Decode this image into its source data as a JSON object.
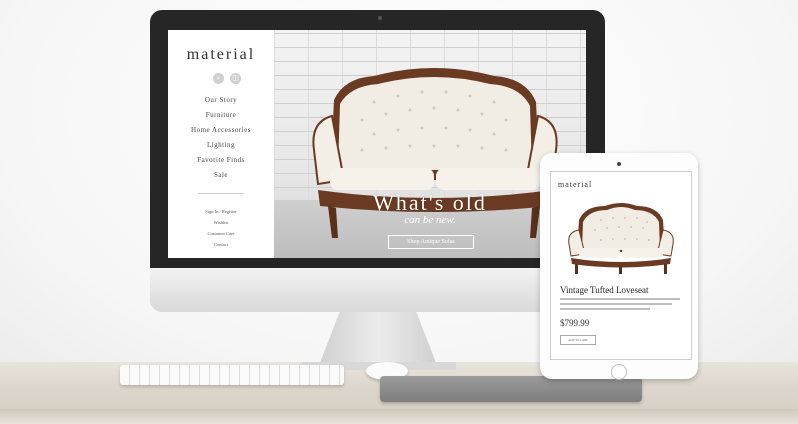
{
  "desktop_site": {
    "logo": "material",
    "nav": [
      "Our Story",
      "Furniture",
      "Home Accessories",
      "Lighting",
      "Favorite Finds",
      "Sale"
    ],
    "sub_nav": [
      "Sign In / Register",
      "Wishlist",
      "Customer Care",
      "Contact"
    ],
    "hero": {
      "title": "What's old",
      "subtitle": "can be new.",
      "button_label": "Shop Antique Sofas"
    }
  },
  "tablet_site": {
    "logo": "material",
    "product_title": "Vintage Tufted Loveseat",
    "price": "$799.99",
    "button_label": "ADD TO CART"
  },
  "icons": {
    "search": "search-icon",
    "cart": "cart-icon"
  }
}
